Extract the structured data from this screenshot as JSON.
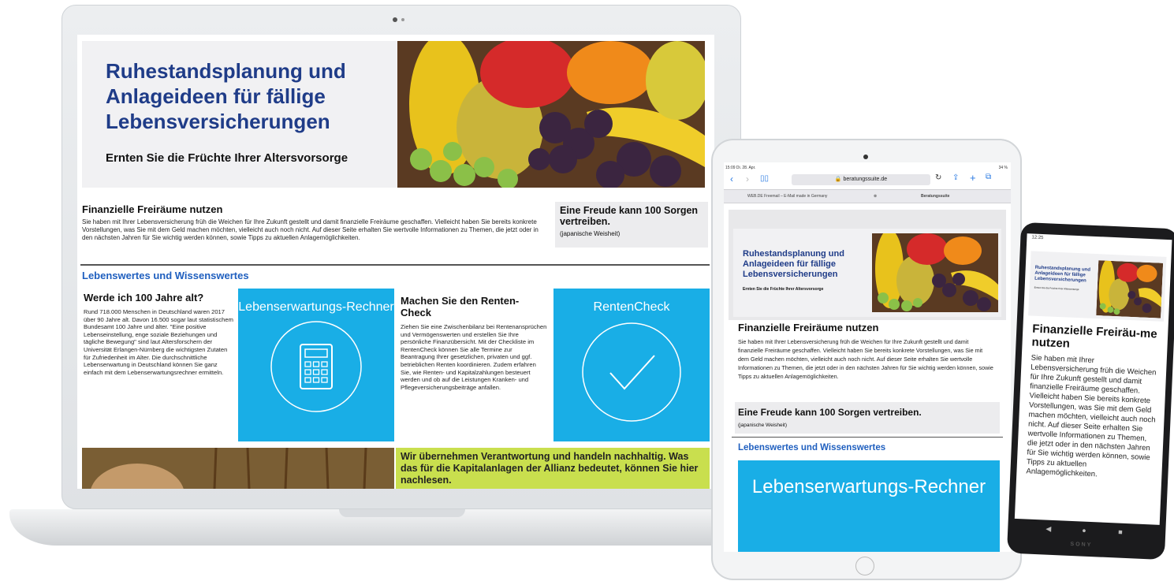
{
  "laptop": {
    "hero_title": "Ruhestandsplanung und Anlageideen für fällige Lebensversicherungen",
    "hero_subtitle": "Ernten Sie die Früchte Ihrer Altersvorsorge",
    "section1_title": "Finanzielle Freiräume nutzen",
    "section1_text": "Sie haben mit Ihrer Lebensversicherung früh die Weichen für Ihre Zukunft gestellt und damit finanzielle Freiräume geschaffen. Vielleicht haben Sie bereits konkrete Vorstellungen, was Sie mit dem Geld machen möchten, vielleicht auch noch nicht. Auf dieser Seite erhalten Sie wertvolle Informationen zu Themen, die jetzt oder in den nächsten Jahren für Sie wichtig werden können, sowie Tipps zu aktuellen Anlagemöglichkeiten.",
    "quote_title": "Eine Freude kann 100 Sorgen vertreiben.",
    "quote_source": "(japanische Weisheit)",
    "lebenswertes": "Lebenswertes und Wissenswertes",
    "col1_title": "Werde ich 100 Jahre alt?",
    "col1_text": "Rund 718.000 Menschen in Deutschland waren 2017 über 90 Jahre alt. Davon 16.500 sogar laut statistischem Bundesamt 100 Jahre und älter. \"Eine positive Lebenseinstellung, enge soziale Beziehungen und tägliche Bewegung\" sind laut Altersforschern der Universität Erlangen-Nürnberg die wichtigsten Zutaten für Zufriedenheit im Alter. Die durchschnittliche Lebenserwartung in Deutschland können Sie ganz einfach mit dem Lebenserwartungsrechner ermitteln.",
    "blue1_title": "Lebenserwartungs-Rechner",
    "col3_title": "Machen Sie den Renten-Check",
    "col3_text": "Ziehen Sie eine Zwischenbilanz bei Rentenansprüchen und Vermögenswerten und erstellen Sie Ihre persönliche Finanzübersicht. Mit der Checkliste im RentenCheck können Sie alle Termine zur Beantragung Ihrer gesetzlichen, privaten und ggf. betrieblichen Renten koordinieren. Zudem erfahren Sie, wie Renten- und Kapitalzahlungen besteuert werden und ob auf die Leistungen Kranken- und Pflegeversicherungsbeiträge anfallen.",
    "blue2_title": "RentenCheck",
    "green_text": "Wir übernehmen Verantwortung und handeln nachhaltig. Was das für die Kapitalanlagen der Allianz bedeutet, können Sie hier nachlesen."
  },
  "tablet": {
    "status_left": "15:09  Di. 28. Apr.",
    "status_right": "34 %",
    "url": "beratungssuite.de",
    "tab1": "WEB.DE Freemail – E-Mail made in Germany",
    "tab2": "Beratungssuite",
    "hero_title": "Ruhestandsplanung und Anlageideen für fällige Lebensversicherungen",
    "hero_subtitle": "Ernten Sie die Früchte Ihrer Altersvorsorge",
    "section_title": "Finanzielle Freiräume nutzen",
    "section_text": "Sie haben mit Ihrer Lebensversicherung früh die Weichen für Ihre Zukunft gestellt und damit finanzielle Freiräume geschaffen. Vielleicht haben Sie bereits konkrete Vorstellungen, was Sie mit dem Geld machen möchten, vielleicht auch noch nicht. Auf dieser Seite erhalten Sie wertvolle Informationen zu Themen, die jetzt oder in den nächsten Jahren für Sie wichtig werden können, sowie Tipps zu aktuellen Anlagemöglichkeiten.",
    "quote_title": "Eine Freude kann 100 Sorgen vertreiben.",
    "quote_source": "(japanische Weisheit)",
    "lebenswertes": "Lebenswertes und Wissenswertes",
    "blue_title": "Lebenserwartungs-Rechner"
  },
  "phone": {
    "time": "12:25",
    "hero_title": "Ruhestandsplanung und Anlageideen für fällige Lebensversicherungen",
    "hero_subtitle": "Ernten Sie die Früchte Ihrer Altersvorsorge",
    "section_title": "Finanzielle Freiräu-me nutzen",
    "section_text": "Sie haben mit Ihrer Lebensversicherung früh die Weichen für Ihre Zukunft gestellt und damit finanzielle Freiräume geschaffen. Vielleicht haben Sie bereits konkrete Vorstellungen, was Sie mit dem Geld machen möchten, vielleicht auch noch nicht. Auf dieser Seite erhalten Sie wertvolle Informationen zu Themen, die jetzt oder in den nächsten Jahren für Sie wichtig werden können, sowie Tipps zu aktuellen Anlagemöglichkeiten.",
    "brand": "SONY"
  },
  "colors": {
    "title_blue": "#1f3c88",
    "link_blue": "#1f5fbf",
    "tile_blue": "#19aee6",
    "green": "#c9df4e"
  }
}
